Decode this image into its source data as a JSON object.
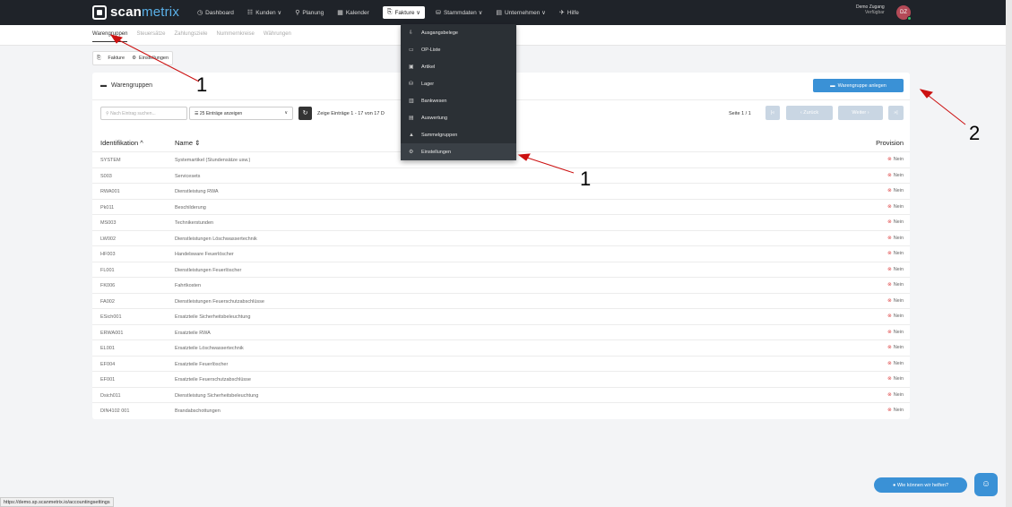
{
  "topbar": {
    "logo_text_a": "scan",
    "logo_text_b": "metrix",
    "nav": [
      {
        "label": "Dashboard",
        "icon": "dashboard-icon"
      },
      {
        "label": "Kunden ∨",
        "icon": "users-icon"
      },
      {
        "label": "Planung",
        "icon": "planning-icon"
      },
      {
        "label": "Kalender",
        "icon": "calendar-icon"
      },
      {
        "label": "Fakture ∨",
        "icon": "invoice-icon"
      },
      {
        "label": "Stammdaten ∨",
        "icon": "database-icon"
      },
      {
        "label": "Unternehmen ∨",
        "icon": "company-icon"
      },
      {
        "label": "Hilfe",
        "icon": "help-icon"
      }
    ],
    "user_name": "Demo Zugang",
    "user_status": "Verfügbar",
    "avatar": "DZ"
  },
  "subnav": [
    "Warengruppen",
    "Steuersätze",
    "Zahlungsziele",
    "Nummernkreise",
    "Währungen"
  ],
  "crumbs": [
    "Fakture",
    "Einstellungen"
  ],
  "card": {
    "title": "Warengruppen",
    "create_button": "Warengruppe anlegen",
    "search_placeholder": "Nach Eintrag suchen...",
    "entries_select": "25 Einträge anzeigen",
    "showing": "Zeige Einträge 1 - 17 von 17 D",
    "page_info": "Seite 1 / 1",
    "pager": {
      "first": "|«",
      "prev": "‹ Zurück",
      "next": "Weiter ›",
      "last": "»|"
    },
    "headers": {
      "id": "Identifikation ^",
      "name": "Name ⇕",
      "provision": "Provision"
    },
    "rows": [
      {
        "id": "SYSTEM",
        "name": "Systemartikel (Stundensätze usw.)",
        "provision": "Nein"
      },
      {
        "id": "S003",
        "name": "Servicesets",
        "provision": "Nein"
      },
      {
        "id": "RWA001",
        "name": "Dienstleistung RWA",
        "provision": "Nein"
      },
      {
        "id": "Pk011",
        "name": "Beschilderung",
        "provision": "Nein"
      },
      {
        "id": "MS003",
        "name": "Technikerstunden",
        "provision": "Nein"
      },
      {
        "id": "LW002",
        "name": "Dienstleistungen Löschwassertechnik",
        "provision": "Nein"
      },
      {
        "id": "HF003",
        "name": "Handelsware Feuerlöscher",
        "provision": "Nein"
      },
      {
        "id": "FL001",
        "name": "Dienstleistungen Feuerlöscher",
        "provision": "Nein"
      },
      {
        "id": "FK006",
        "name": "Fahrtkosten",
        "provision": "Nein"
      },
      {
        "id": "FA002",
        "name": "Dienstleistungen Feuerschutzabschlüsse",
        "provision": "Nein"
      },
      {
        "id": "ESich001",
        "name": "Ersatzteile Sicherheitsbeleuchtung",
        "provision": "Nein"
      },
      {
        "id": "ERWA001",
        "name": "Ersatzteile RWA",
        "provision": "Nein"
      },
      {
        "id": "EL001",
        "name": "Ersatzteile Löschwassertechnik",
        "provision": "Nein"
      },
      {
        "id": "EF004",
        "name": "Ersatzteile Feuerlöscher",
        "provision": "Nein"
      },
      {
        "id": "EF001",
        "name": "Ersatzteile Feuerschutzabschlüsse",
        "provision": "Nein"
      },
      {
        "id": "Dsich011",
        "name": "Dienstleistung Sicherheitsbeleuchtung",
        "provision": "Nein"
      },
      {
        "id": "DIN4102 001",
        "name": "Brandabschottungen",
        "provision": "Nein"
      }
    ]
  },
  "dropdown": [
    {
      "label": "Ausgangsbelege",
      "icon": "outgoing-icon"
    },
    {
      "label": "OP-Liste",
      "icon": "list-icon"
    },
    {
      "label": "Artikel",
      "icon": "article-icon"
    },
    {
      "label": "Lager",
      "icon": "warehouse-icon"
    },
    {
      "label": "Bankwesen",
      "icon": "bank-icon"
    },
    {
      "label": "Auswertung",
      "icon": "chart-icon"
    },
    {
      "label": "Sammelgruppen",
      "icon": "group-icon"
    },
    {
      "label": "Einstellungen",
      "icon": "gear-icon"
    }
  ],
  "annotations": {
    "a1": "1",
    "a2": "1",
    "a3": "2"
  },
  "status_url": "https://demo.sp.scanmetrix.io/accountingsettings",
  "help": {
    "pill": "● Wie können wir helfen?",
    "chat": "☺"
  },
  "colors": {
    "accent": "#3a91d6",
    "topbar": "#1f2329",
    "danger": "#e04b4b"
  }
}
